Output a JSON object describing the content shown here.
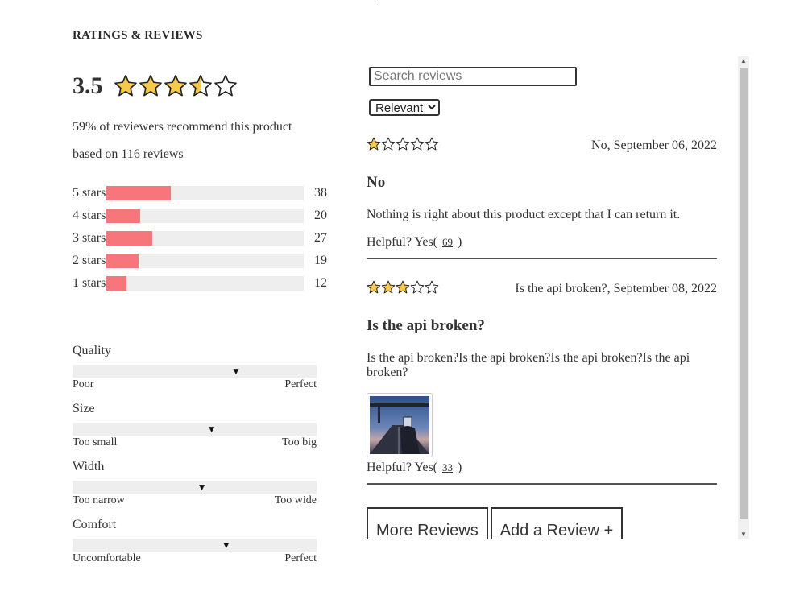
{
  "section_title": "RATINGS & REVIEWS",
  "summary": {
    "average": "3.5",
    "average_stars": 3.5,
    "recommend_text": "59% of reviewers recommend this product",
    "based_on_text": "based on 116 reviews"
  },
  "breakdown": [
    {
      "label": "5 stars",
      "count": "38",
      "fraction": 0.327
    },
    {
      "label": "4 stars",
      "count": "20",
      "fraction": 0.172
    },
    {
      "label": "3 stars",
      "count": "27",
      "fraction": 0.233
    },
    {
      "label": "2 stars",
      "count": "19",
      "fraction": 0.164
    },
    {
      "label": "1 stars",
      "count": "12",
      "fraction": 0.103
    }
  ],
  "characteristics": [
    {
      "name": "Quality",
      "low": "Poor",
      "high": "Perfect",
      "value": 0.67
    },
    {
      "name": "Size",
      "low": "Too small",
      "high": "Too big",
      "value": 0.57
    },
    {
      "name": "Width",
      "low": "Too narrow",
      "high": "Too wide",
      "value": 0.53
    },
    {
      "name": "Comfort",
      "low": "Uncomfortable",
      "high": "Perfect",
      "value": 0.63
    }
  ],
  "search": {
    "placeholder": "Search reviews"
  },
  "sort": {
    "selected": "Relevant"
  },
  "reviews": [
    {
      "rating": 1,
      "date": "No, September 06, 2022",
      "title": "No",
      "body": "Nothing is right about this product except that I can return it.",
      "helpful_label": "Helpful? Yes(",
      "helpful_count": "69",
      "helpful_close": ")"
    },
    {
      "rating": 3,
      "date": "Is the api broken?, September 08, 2022",
      "title": "Is the api broken?",
      "body": "Is the api broken?Is the api broken?Is the api broken?Is the api broken?",
      "helpful_label": "Helpful? Yes(",
      "helpful_count": "33",
      "helpful_close": ")"
    }
  ],
  "buttons": {
    "more": "More Reviews",
    "add": "Add a Review +"
  },
  "colors": {
    "bar_fill": "#f6767c",
    "star_fill": "#f7c948",
    "track": "#eeeeee"
  }
}
